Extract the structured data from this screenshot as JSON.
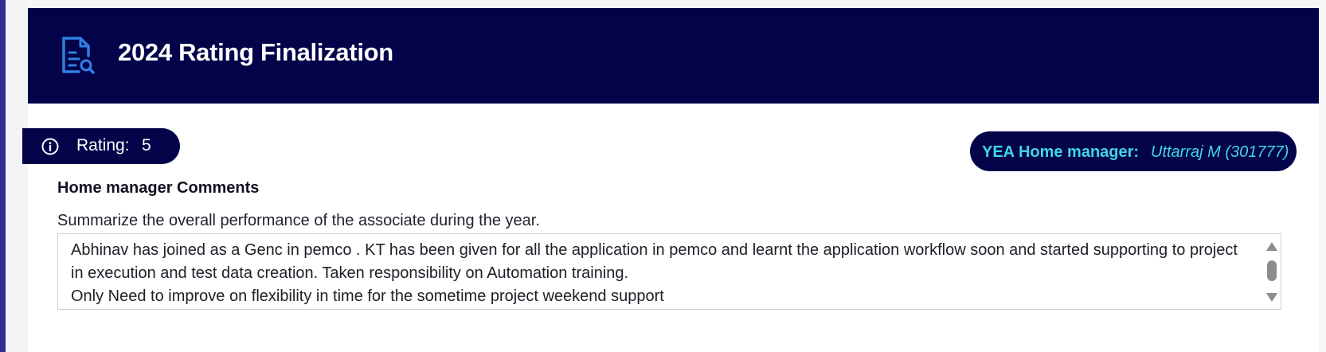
{
  "header": {
    "title": "2024 Rating Finalization",
    "icon": "document-search-icon"
  },
  "rating": {
    "label": "Rating:",
    "value": "5",
    "icon": "info-icon"
  },
  "home_manager": {
    "label": "YEA Home manager:",
    "name": "Uttarraj M (301777)"
  },
  "comments": {
    "section_title": "Home manager Comments",
    "prompt": "Summarize the overall performance of the associate during the year.",
    "text": "Abhinav has joined as a Genc in pemco . KT has been given for all the application in pemco and learnt the application workflow soon and started supporting to project in execution and test data creation. Taken responsibility on Automation training.\nOnly Need to improve on flexibility in time for the sometime project weekend support"
  },
  "colors": {
    "header_bg": "#03034a",
    "accent_cyan": "#3fd6e6",
    "icon_blue": "#2f7fe0",
    "left_rail": "#2c2f8f"
  }
}
